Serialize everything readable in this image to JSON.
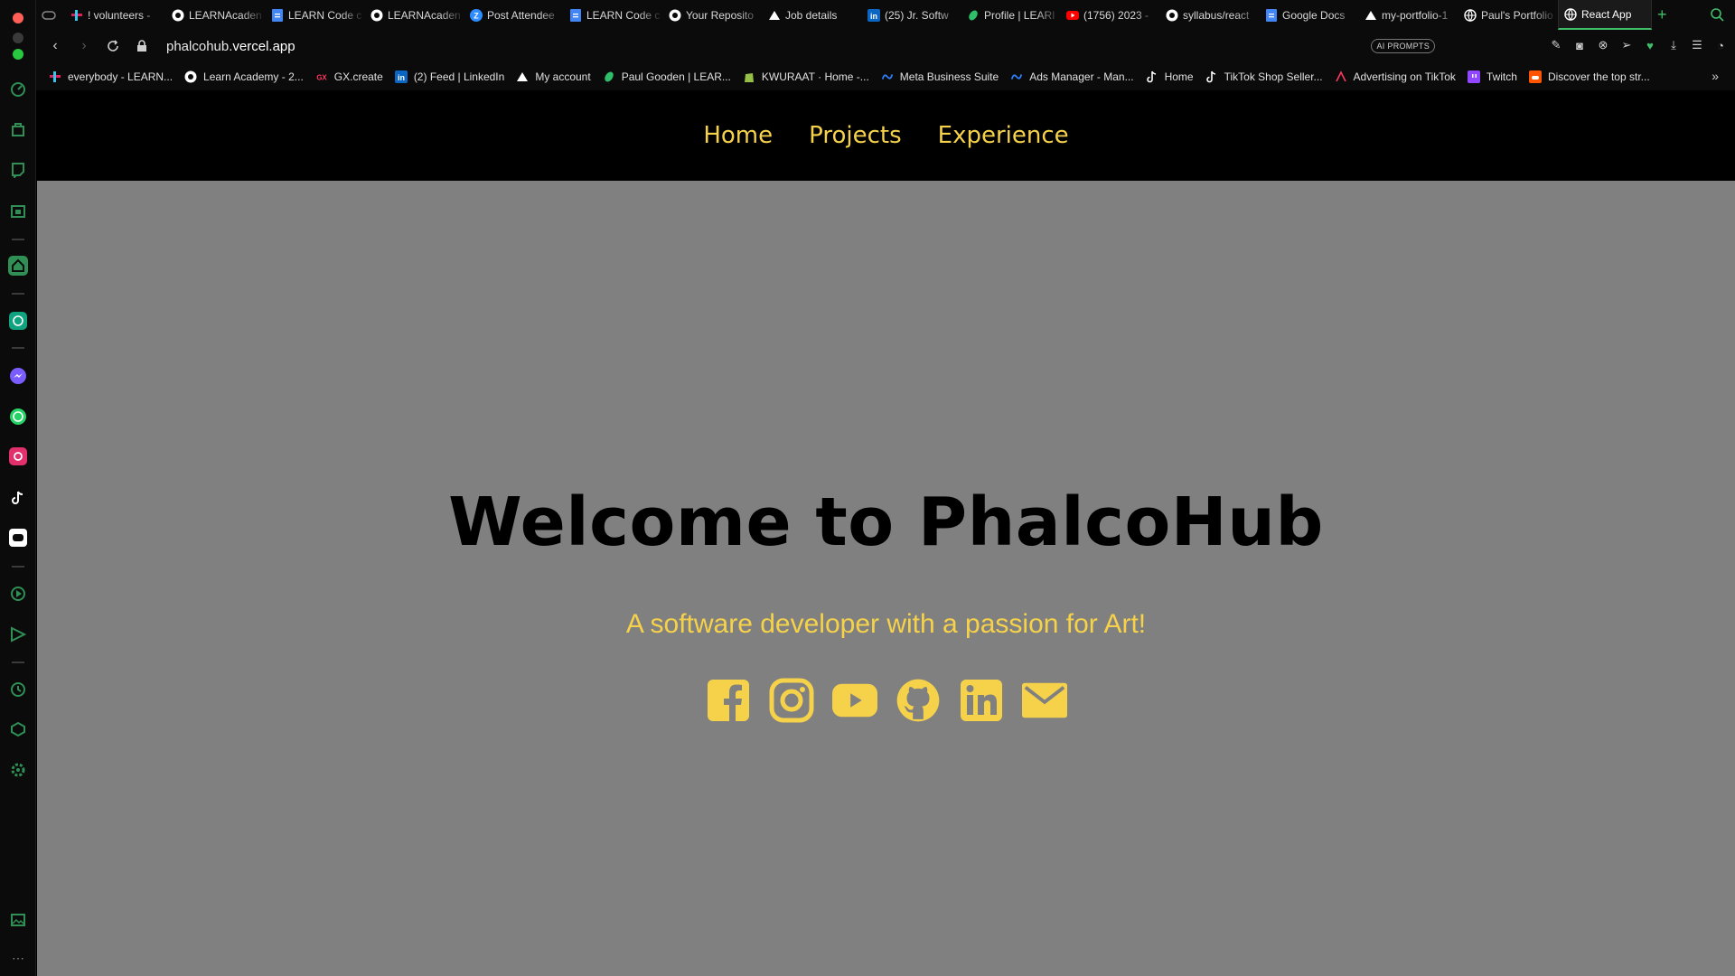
{
  "browser": {
    "tabs": [
      {
        "label": "! volunteers -",
        "icon": "slack-icon"
      },
      {
        "label": "LEARNAcaden",
        "icon": "github-icon"
      },
      {
        "label": "LEARN Code c",
        "icon": "google-docs-icon"
      },
      {
        "label": "LEARNAcaden",
        "icon": "github-icon"
      },
      {
        "label": "Post Attendee",
        "icon": "zoom-icon"
      },
      {
        "label": "LEARN Code c",
        "icon": "google-docs-icon"
      },
      {
        "label": "Your Reposito",
        "icon": "github-icon"
      },
      {
        "label": "Job details",
        "icon": "climb-icon"
      },
      {
        "label": "(25) Jr. Softw",
        "icon": "linkedin-icon"
      },
      {
        "label": "Profile | LEARI",
        "icon": "leaf-icon"
      },
      {
        "label": "(1756) 2023 -",
        "icon": "youtube-icon"
      },
      {
        "label": "syllabus/react",
        "icon": "github-icon"
      },
      {
        "label": "Google Docs",
        "icon": "google-docs-icon"
      },
      {
        "label": "my-portfolio-1",
        "icon": "vercel-icon"
      },
      {
        "label": "Paul's Portfolio",
        "icon": "globe-icon"
      },
      {
        "label": "React App",
        "icon": "globe-icon",
        "active": true
      }
    ],
    "new_tab_symbol": "+",
    "url_host": "phalcohub.",
    "url_domain": "vercel.app",
    "ai_prompts_label": "AI PROMPTS",
    "bookmarks": [
      {
        "label": "everybody - LEARN...",
        "icon": "slack-icon"
      },
      {
        "label": "Learn Academy - 2...",
        "icon": "github-icon"
      },
      {
        "label": "GX.create",
        "icon": "gx-icon"
      },
      {
        "label": "(2) Feed | LinkedIn",
        "icon": "linkedin-icon"
      },
      {
        "label": "My account",
        "icon": "climb-icon"
      },
      {
        "label": "Paul Gooden | LEAR...",
        "icon": "leaf-icon"
      },
      {
        "label": "KWURAAT · Home -...",
        "icon": "shopify-icon"
      },
      {
        "label": "Meta Business Suite",
        "icon": "meta-icon"
      },
      {
        "label": "Ads Manager - Man...",
        "icon": "meta-icon"
      },
      {
        "label": "Home",
        "icon": "tiktok-icon"
      },
      {
        "label": "TikTok Shop Seller...",
        "icon": "tiktok-icon"
      },
      {
        "label": "Advertising on TikTok",
        "icon": "tiktok-ads-icon"
      },
      {
        "label": "Twitch",
        "icon": "twitch-icon"
      },
      {
        "label": "Discover the top str...",
        "icon": "soundcloud-icon"
      }
    ],
    "bookmarks_more": "»"
  },
  "site": {
    "nav": [
      "Home",
      "Projects",
      "Experience"
    ],
    "title": "Welcome to PhalcoHub",
    "subtitle": "A software developer with a passion for Art!",
    "socials": [
      "facebook-icon",
      "instagram-icon",
      "youtube-icon",
      "github-icon",
      "linkedin-icon",
      "email-icon"
    ]
  },
  "colors": {
    "accent": "#f5d24a",
    "page_bg": "#808080",
    "nav_bg": "#000000",
    "browser_green": "#3fbf6a"
  }
}
